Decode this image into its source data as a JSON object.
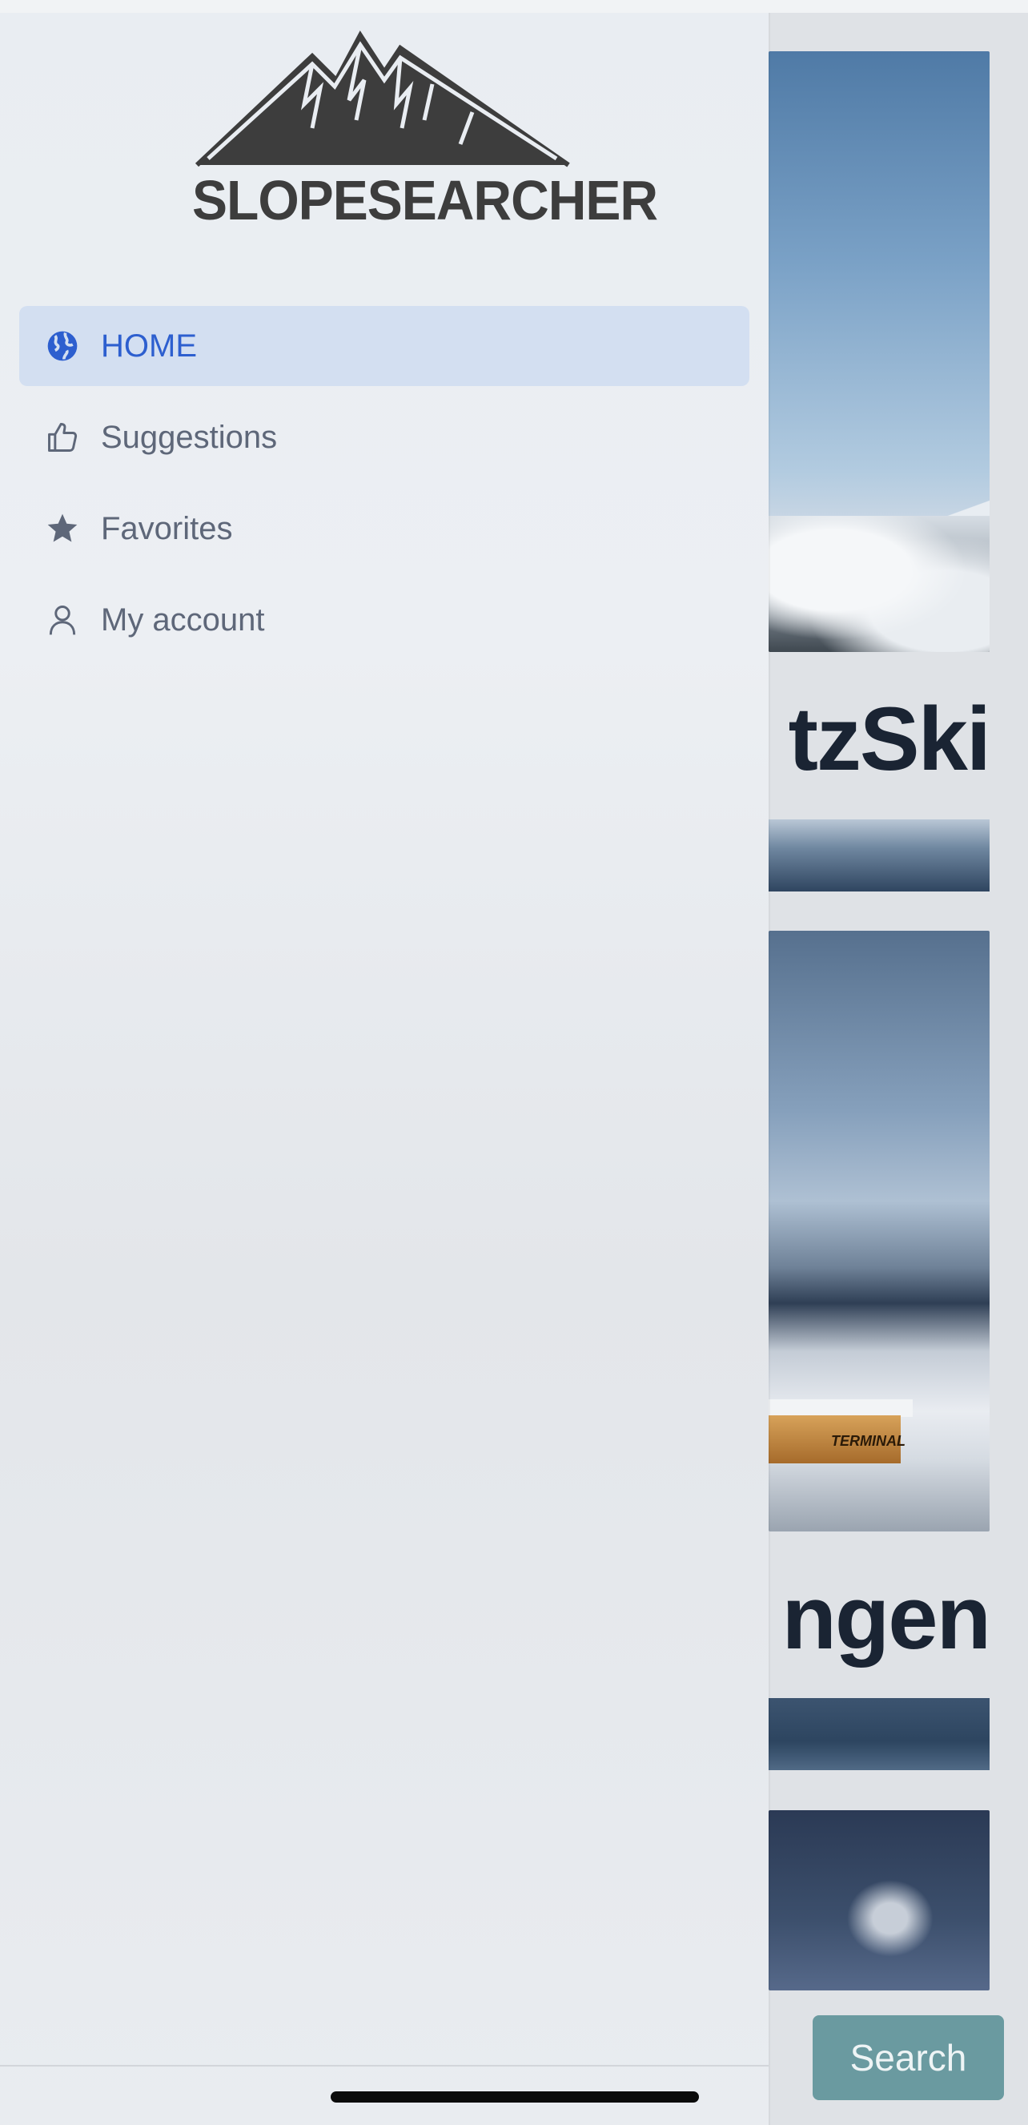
{
  "background": {
    "card1_title_fragment": "tzSki",
    "card2_title_fragment": "ngen",
    "terminal_sign": "TERMINAL",
    "search_button": "Search"
  },
  "drawer": {
    "logo_text": "SLOPESEARCHER",
    "menu": [
      {
        "label": "HOME",
        "icon": "globe-icon",
        "active": true
      },
      {
        "label": "Suggestions",
        "icon": "thumbs-up-icon",
        "active": false
      },
      {
        "label": "Favorites",
        "icon": "star-icon",
        "active": false
      },
      {
        "label": "My account",
        "icon": "user-icon",
        "active": false
      }
    ]
  },
  "colors": {
    "active_accent": "#2d5fcf",
    "active_bg": "#d3dff1",
    "search_button_bg": "#6a9aa0"
  }
}
